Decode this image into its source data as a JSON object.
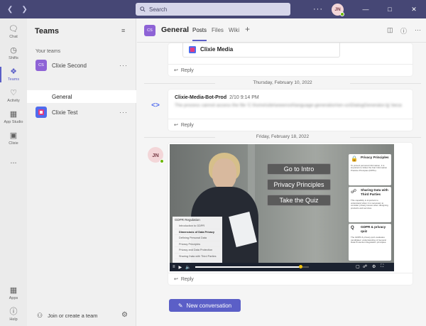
{
  "titlebar": {
    "search_placeholder": "Search",
    "user_initials": "JN"
  },
  "rail": {
    "items": [
      {
        "label": "Chat",
        "icon": "chat-icon"
      },
      {
        "label": "Shifts",
        "icon": "shifts-icon"
      },
      {
        "label": "Teams",
        "icon": "teams-icon",
        "active": true
      },
      {
        "label": "Activity",
        "icon": "bell-icon"
      },
      {
        "label": "App Studio",
        "icon": "app-studio-icon"
      },
      {
        "label": "Clixie",
        "icon": "clixie-icon"
      }
    ],
    "more": "...",
    "apps_label": "Apps",
    "help_label": "Help"
  },
  "teams_panel": {
    "title": "Teams",
    "section_label": "Your teams",
    "teams": [
      {
        "name": "Clixie Second",
        "initials": "CS",
        "color": "#8e63d6"
      },
      {
        "name": "Clixie Test",
        "initials": "",
        "color": "#4f6bed"
      }
    ],
    "active_channel": "General",
    "join_label": "Join or create a team"
  },
  "channel_header": {
    "initials": "CS",
    "title": "General",
    "tabs": [
      "Posts",
      "Files",
      "Wiki"
    ]
  },
  "feed": {
    "first_card_title": "Clixie Media",
    "reply_label": "Reply",
    "date_1": "Thursday, February 10, 2022",
    "bot_message": {
      "sender": "Clixie-Media-Bot-Prod",
      "time": "2/10 9:14 PM",
      "line_1": "The process cannot access the file 'C:\\home\\site\\wwwroot\\language-generation\\en-us\\DialogGenerator.lg' because it is being used by another process.",
      "line_2": ""
    },
    "date_2": "Friday, February 18, 2022",
    "user_initials": "JN",
    "video": {
      "buttons": [
        "Go to Intro",
        "Privacy Principles",
        "Take the Quiz"
      ],
      "side_cards": [
        {
          "title": "Privacy Principles",
          "icon": "lock-icon",
          "text": "To protect personal information, it is important to follow the Fair Information Practice Principles (FIPPs)."
        },
        {
          "title": "Sharing Data with Third Parties",
          "icon": "share-icon",
          "text": "This capability is important to understand when it is necessary to consider privacy issues when designing products and services."
        },
        {
          "title": "GDPR & privacy quiz",
          "icon": "quiz-icon",
          "text": "The GDPR & privacy quiz evaluates candidates' understanding of General Data Protection Regulation principles."
        }
      ],
      "menu_title": "GDPR Regulation",
      "menu_items": [
        "Introduction to GDPR",
        "Dimensions of Data Privacy",
        "Defining Personal Data",
        "Privacy Principles",
        "Privacy and Data Protection",
        "Sharing Data with Third Parties"
      ],
      "current_menu_index": 1,
      "progress": 0.93
    },
    "new_conversation_label": "New conversation"
  }
}
